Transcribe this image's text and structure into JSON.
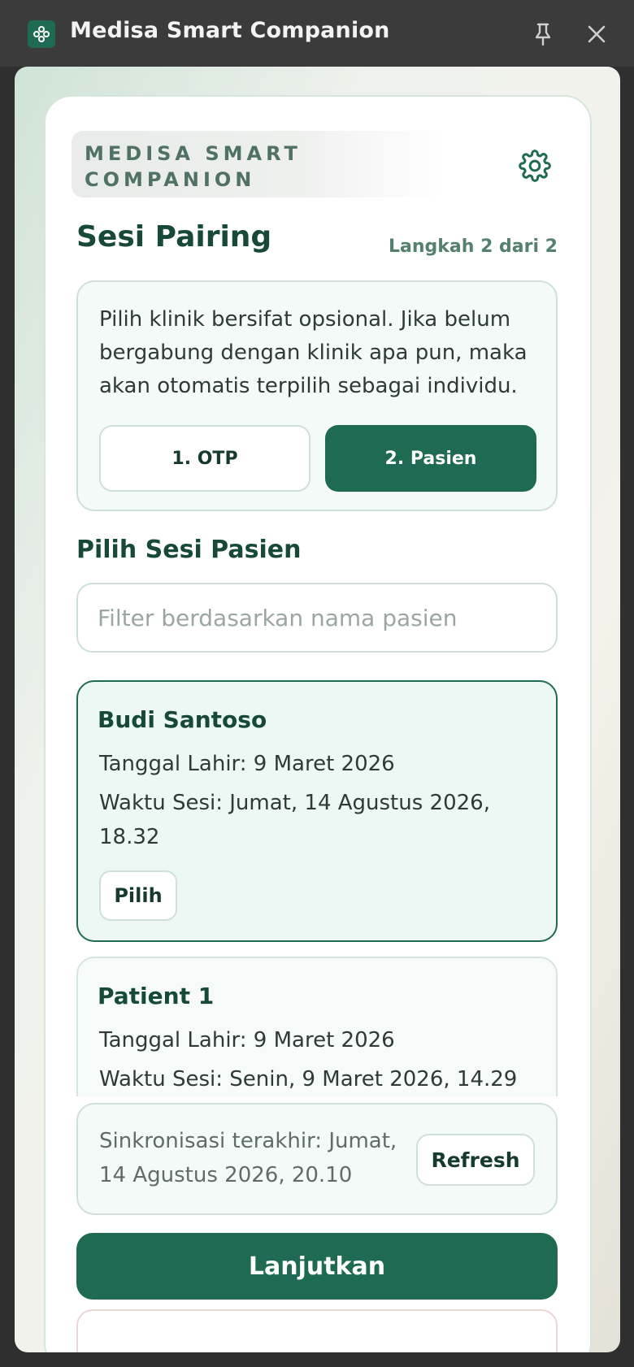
{
  "window": {
    "title": "Medisa Smart Companion",
    "icons": {
      "app": "app-logo-icon",
      "pin": "pin-icon",
      "close": "close-icon",
      "settings": "gear-icon"
    }
  },
  "header": {
    "brand": "MEDISA SMART COMPANION",
    "title": "Sesi Pairing",
    "step": "Langkah 2 dari 2"
  },
  "info": {
    "text": "Pilih klinik bersifat opsional. Jika belum bergabung dengan klinik apa pun, maka akan otomatis terpilih sebagai individu.",
    "steps": [
      {
        "label": "1. OTP",
        "active": false
      },
      {
        "label": "2. Pasien",
        "active": true
      }
    ]
  },
  "patients": {
    "title": "Pilih Sesi Pasien",
    "filter_placeholder": "Filter berdasarkan nama pasien",
    "filter_value": "",
    "items": [
      {
        "name": "Budi Santoso",
        "dob": "Tanggal Lahir: 9 Maret 2026",
        "session": "Waktu Sesi: Jumat, 14 Agustus 2026, 18.32",
        "action": "Pilih",
        "selected": true
      },
      {
        "name": "Patient 1",
        "dob": "Tanggal Lahir: 9 Maret 2026",
        "session": "Waktu Sesi: Senin, 9 Maret 2026, 14.29",
        "selected": false
      }
    ]
  },
  "sync": {
    "text": "Sinkronisasi terakhir: Jumat, 14 Agustus 2026, 20.10",
    "refresh_label": "Refresh"
  },
  "footer": {
    "continue_label": "Lanjutkan"
  },
  "colors": {
    "accent": "#1f6a52",
    "heading": "#17493a",
    "selected_bg": "#edf7f3"
  }
}
